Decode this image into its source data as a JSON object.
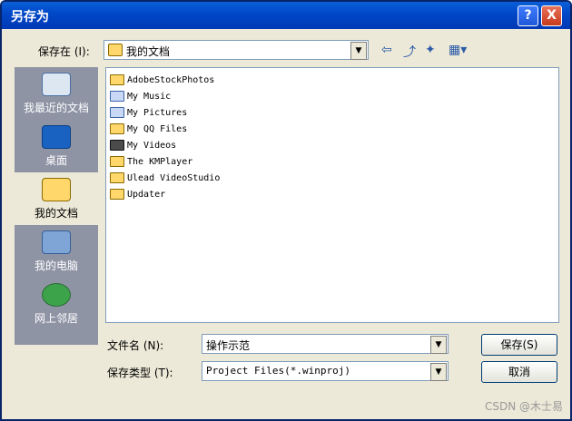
{
  "window": {
    "title": "另存为",
    "help_label": "?",
    "close_label": "X"
  },
  "lookin": {
    "label": "保存在 (I):",
    "value": "我的文档"
  },
  "places": [
    {
      "label": "我最近的文档"
    },
    {
      "label": "桌面"
    },
    {
      "label": "我的文档"
    },
    {
      "label": "我的电脑"
    },
    {
      "label": "网上邻居"
    }
  ],
  "files": [
    {
      "name": "AdobeStockPhotos"
    },
    {
      "name": "My Music"
    },
    {
      "name": "My Pictures"
    },
    {
      "name": "My QQ Files"
    },
    {
      "name": "My Videos"
    },
    {
      "name": "The KMPlayer"
    },
    {
      "name": "Ulead VideoStudio"
    },
    {
      "name": "Updater"
    }
  ],
  "filename": {
    "label": "文件名 (N):",
    "value": "操作示范"
  },
  "filetype": {
    "label": "保存类型 (T):",
    "value": "Project Files(*.winproj)"
  },
  "buttons": {
    "save": "保存(S)",
    "cancel": "取消"
  },
  "watermark": "CSDN @木士易"
}
